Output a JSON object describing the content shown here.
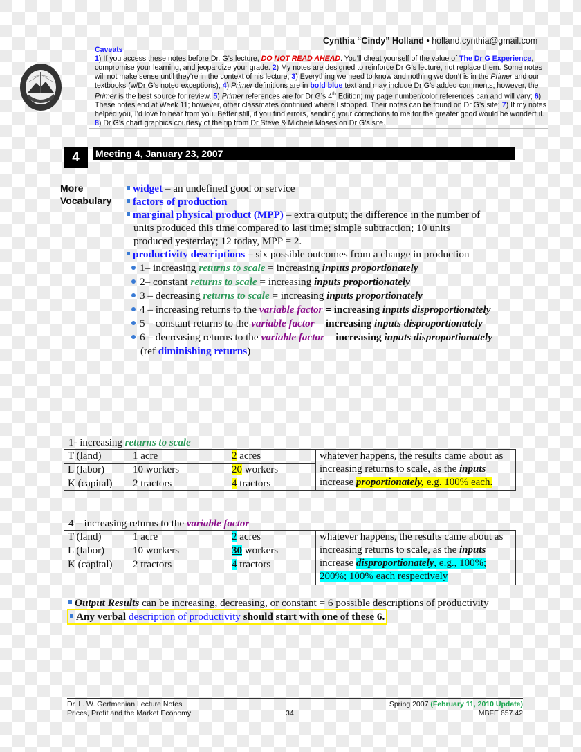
{
  "header": {
    "author_name": "Cynthia “Cindy” Holland",
    "bullet": "•",
    "author_email": "holland.cynthia@gmail.com",
    "logo": "university-seal-icon"
  },
  "caveats": {
    "title": "Caveats",
    "p1_num": "1",
    "p1_a": ") If you access these notes before Dr. G’s lecture, ",
    "p1_warn": "DO NOT READ AHEAD",
    "p1_b": ".  You’ll cheat yourself of the value of ",
    "p1_brand": "The Dr G Experience",
    "p1_c": ", compromise your learning, and jeopardize your grade. ",
    "p2_num": "2",
    "p2": ") My notes are designed to reinforce Dr G’s lecture, not replace them.  Some notes will not make sense until they’re in the context of his lecture; ",
    "p3_num": "3",
    "p3_a": ") Everything we need to know and nothing we don’t is in the ",
    "p3_primer": "Primer",
    "p3_b": " and our textbooks (w/Dr G’s noted exceptions); ",
    "p4_num": "4",
    "p4_a": ") ",
    "p4_primer": "Primer",
    "p4_b": " definitions are in ",
    "p4_bold_blue": "bold blue",
    "p4_c": " text and may include Dr G’s added comments; however, the ",
    "p4_primer2": "Primer",
    "p4_d": " is the best source for review.  ",
    "p5_num": "5",
    "p5_a": ") ",
    "p5_primer": "Primer",
    "p5_b": " references are for Dr G’s 4",
    "p5_sup": "th",
    "p5_c": " Edition; my page number/color references can and will vary; ",
    "p6_num": "6",
    "p6": ") These notes end at Week 11; however, other classmates continued where I stopped.  Their notes can be found on Dr G’s site; ",
    "p7_num": "7",
    "p7": ") If my notes helped you, I’d love to hear from you.  Better still, if you find errors, sending your corrections to me for the greater good would be wonderful. ",
    "p8_num": "8",
    "p8": ") Dr G’s chart graphics courtesy of the tip from Dr Steve & Michele Moses on Dr G’s site."
  },
  "meeting": {
    "number": "4",
    "title": "Meeting 4, January 23, 2007"
  },
  "vocab": {
    "label_line1": "More",
    "label_line2": "Vocabulary",
    "items": [
      {
        "term": "widget",
        "def": " – an undefined good or service"
      },
      {
        "term": "factors of production",
        "def": ""
      },
      {
        "term": "marginal physical product (MPP)",
        "def": " – extra output; the difference in the number of",
        "cont1": "units produced this time compared to last time; simple subtraction; 10 units",
        "cont2": "produced yesterday; 12 today, MPP = 2."
      },
      {
        "term": "productivity descriptions",
        "def": " – six possible outcomes from a change in production"
      }
    ],
    "outcomes": [
      {
        "pre": "1– increasing ",
        "key": "returns to scale",
        "mid": " = increasing ",
        "inputs": "inputs proportionately",
        "style": "green"
      },
      {
        "pre": "2– constant ",
        "key": "returns to scale",
        "mid": " = increasing ",
        "inputs": "inputs proportionately",
        "style": "green"
      },
      {
        "pre": "3 – decreasing ",
        "key": "returns to scale",
        "mid": " = increasing ",
        "inputs": "inputs proportionately",
        "style": "green"
      },
      {
        "pre": "4 – increasing returns to the ",
        "key": "variable factor",
        "mid": " = increasing ",
        "inputs": "inputs disproportionately",
        "style": "purple"
      },
      {
        "pre": "5 – constant returns to the ",
        "key": "variable factor",
        "mid": " = increasing ",
        "inputs": "inputs disproportionately",
        "style": "purple"
      },
      {
        "pre": "6 – decreasing returns to the ",
        "key": "variable factor",
        "mid": " = increasing ",
        "inputs": "inputs disproportionately",
        "style": "purple"
      }
    ],
    "ref_pre": "(ref ",
    "ref_term": "diminishing returns",
    "ref_post": ")"
  },
  "table1": {
    "caption_pre": "1- increasing ",
    "caption_key": "returns to scale",
    "rows": [
      {
        "factor": "T (land)",
        "before": "1 acre",
        "after_num": "2",
        "after_unit": " acres"
      },
      {
        "factor": "L (labor)",
        "before": "10 workers",
        "after_num": "20",
        "after_unit": " workers"
      },
      {
        "factor": "K (capital)",
        "before": " 2 tractors",
        "after_num": "4",
        "after_unit": " tractors"
      }
    ],
    "note_a": "whatever happens, the results came about as increasing returns to scale, as the ",
    "note_inputs": "inputs",
    "note_b": " increase ",
    "note_hl": "proportionately,",
    "note_hl2": " e.g. 100% each."
  },
  "table2": {
    "caption_pre": "4 – increasing returns to the ",
    "caption_key": "variable factor",
    "rows": [
      {
        "factor": "T (land)",
        "before": "1 acre",
        "after_num": "2",
        "after_unit": " acres"
      },
      {
        "factor": "L (labor)",
        "before": "10 workers",
        "after_num": "30",
        "after_unit": " workers"
      },
      {
        "factor": "K (capital)",
        "before": " 2 tractors",
        "after_num": "4",
        "after_unit": " tractors"
      }
    ],
    "note_a": "whatever happens, the results came about as increasing returns to scale, as the ",
    "note_inputs": "inputs",
    "note_b": " increase ",
    "note_hl": "disproportionately",
    "note_hl2": ", e.g., 100%; 200%; 100% each respectively"
  },
  "summary": {
    "out_term": "Output Results",
    "out_text": " can be increasing, decreasing, or constant = 6 possible descriptions of productivity",
    "any_a": "Any verbal ",
    "any_link": "description of productivity",
    "any_b": " should start with one of these 6."
  },
  "footer": {
    "left1": "Dr. L. W. Gertmenian Lecture Notes",
    "left2": "Prices, Profit and the Market Economy",
    "page": "34",
    "right1_a": "Spring 2007 ",
    "right1_update": "(February 11, 2010 Update)",
    "right2": "MBFE 657.42"
  },
  "colors": {
    "term_blue": "#1a1aff",
    "rts_green": "#2e9a5a",
    "vf_purple": "#8b0f8b",
    "warning_red": "#e00000",
    "highlight_yellow": "#ffff00",
    "highlight_cyan": "#00ffff",
    "update_green": "#16a34a"
  }
}
